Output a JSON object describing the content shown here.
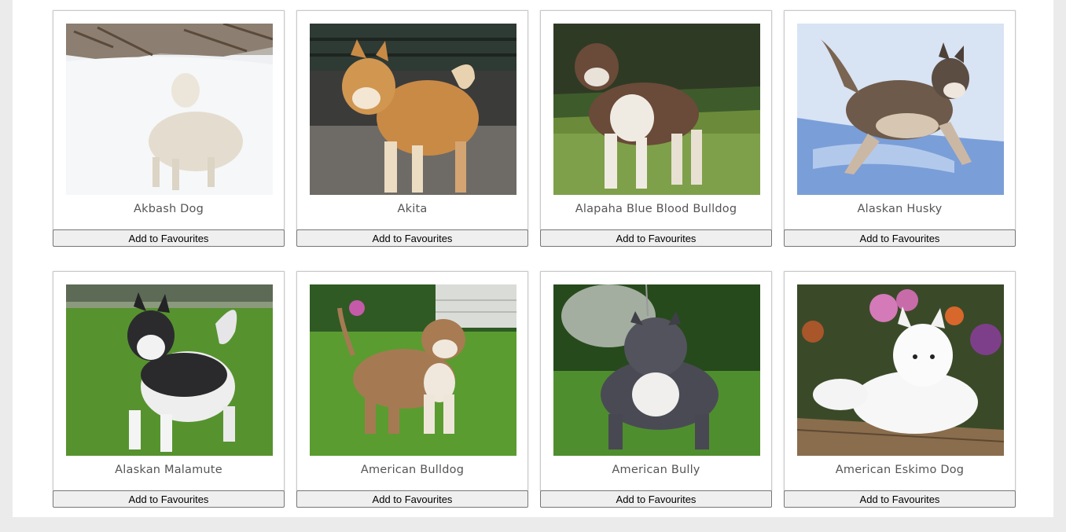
{
  "button_label": "Add to Favourites",
  "breeds": [
    {
      "name": "Akbash Dog",
      "photo": "white-dog-in-snow"
    },
    {
      "name": "Akita",
      "photo": "akita-dog"
    },
    {
      "name": "Alapaha Blue Blood Bulldog",
      "photo": "brown-white-bulldog-on-grass"
    },
    {
      "name": "Alaskan Husky",
      "photo": "husky-running-in-snow"
    },
    {
      "name": "Alaskan Malamute",
      "photo": "malamute-on-lawn"
    },
    {
      "name": "American Bulldog",
      "photo": "bulldog-on-lawn"
    },
    {
      "name": "American Bully",
      "photo": "grey-bully-on-grass"
    },
    {
      "name": "American Eskimo Dog",
      "photo": "white-spitz-on-deck"
    }
  ]
}
